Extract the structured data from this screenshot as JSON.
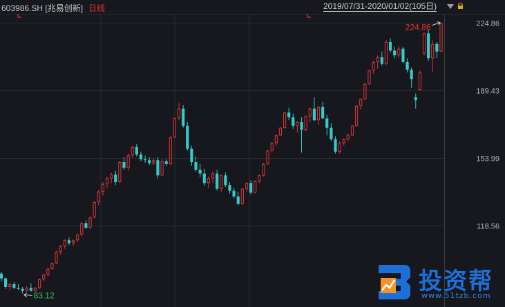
{
  "header": {
    "symbol": "603986.SH",
    "name": "[兆易创新]",
    "period": "日线",
    "date_range": "2019/07/31-2020/01/02(105日)"
  },
  "watermark": {
    "brand": "投资帮",
    "url": "www.51tzb.com"
  },
  "colors": {
    "up": "#e0343a",
    "down": "#36c9c9",
    "background": "#16181d",
    "grid": "#2a2d33",
    "axis_text": "#b4b4b4"
  },
  "chart_data": {
    "type": "candlestick",
    "title": "603986.SH [兆易创新] 日线",
    "period": "2019/07/31-2020/01/02",
    "bar_count": 105,
    "y_ticks": [
      118.56,
      153.99,
      189.43,
      224.86
    ],
    "ylim": [
      76.0,
      229.8
    ],
    "grid": true,
    "annotations": {
      "high": 224.86,
      "low": 83.12
    },
    "ohlc": [
      [
        93.5,
        94.5,
        89.5,
        91.0
      ],
      [
        91.0,
        91.5,
        85.5,
        86.5
      ],
      [
        86.5,
        88.5,
        84.5,
        88.0
      ],
      [
        88.0,
        89.0,
        85.5,
        86.0
      ],
      [
        86.0,
        88.0,
        85.0,
        85.5
      ],
      [
        85.5,
        86.5,
        83.12,
        84.5
      ],
      [
        84.5,
        87.0,
        83.5,
        86.0
      ],
      [
        86.0,
        88.5,
        84.0,
        84.5
      ],
      [
        84.5,
        86.5,
        83.5,
        86.0
      ],
      [
        86.0,
        91.0,
        85.5,
        90.5
      ],
      [
        90.5,
        93.5,
        89.5,
        93.0
      ],
      [
        93.0,
        96.5,
        92.0,
        96.0
      ],
      [
        96.0,
        99.5,
        95.5,
        99.0
      ],
      [
        99.0,
        105.5,
        98.5,
        105.0
      ],
      [
        105.0,
        108.5,
        103.5,
        108.0
      ],
      [
        108.0,
        111.5,
        106.5,
        111.0
      ],
      [
        111.0,
        112.5,
        108.5,
        109.5
      ],
      [
        109.5,
        111.5,
        108.0,
        111.0
      ],
      [
        111.0,
        114.5,
        110.0,
        114.0
      ],
      [
        114.0,
        120.5,
        113.0,
        120.0
      ],
      [
        120.0,
        121.5,
        117.0,
        117.5
      ],
      [
        117.5,
        123.5,
        117.0,
        123.0
      ],
      [
        123.0,
        131.5,
        122.5,
        131.0
      ],
      [
        131.0,
        137.5,
        129.5,
        136.5
      ],
      [
        136.5,
        141.5,
        134.5,
        140.5
      ],
      [
        140.5,
        144.5,
        138.5,
        143.5
      ],
      [
        143.5,
        146.5,
        141.0,
        145.5
      ],
      [
        145.5,
        147.5,
        140.0,
        141.5
      ],
      [
        141.5,
        152.5,
        141.0,
        152.0
      ],
      [
        152.0,
        154.5,
        148.0,
        149.0
      ],
      [
        149.0,
        156.5,
        147.5,
        155.5
      ],
      [
        155.5,
        160.5,
        154.5,
        160.0
      ],
      [
        160.0,
        161.5,
        155.0,
        156.0
      ],
      [
        156.0,
        157.5,
        152.5,
        153.5
      ],
      [
        153.5,
        155.5,
        151.5,
        153.0
      ],
      [
        153.0,
        154.5,
        150.5,
        151.5
      ],
      [
        151.5,
        154.0,
        150.5,
        153.0
      ],
      [
        153.0,
        154.5,
        143.5,
        145.0
      ],
      [
        145.0,
        153.5,
        144.5,
        152.5
      ],
      [
        152.5,
        153.5,
        150.0,
        151.0
      ],
      [
        151.0,
        165.5,
        150.5,
        165.0
      ],
      [
        165.0,
        175.5,
        164.5,
        175.0
      ],
      [
        175.0,
        183.0,
        174.0,
        180.0
      ],
      [
        180.0,
        182.0,
        170.0,
        171.0
      ],
      [
        171.0,
        173.0,
        158.0,
        159.0
      ],
      [
        159.0,
        160.5,
        150.0,
        152.0
      ],
      [
        152.0,
        155.0,
        147.0,
        148.0
      ],
      [
        148.0,
        151.0,
        144.0,
        146.0
      ],
      [
        146.0,
        148.5,
        139.5,
        141.0
      ],
      [
        141.0,
        144.5,
        138.5,
        143.5
      ],
      [
        143.5,
        147.0,
        141.0,
        146.0
      ],
      [
        146.0,
        148.0,
        137.0,
        138.0
      ],
      [
        138.0,
        145.5,
        136.5,
        145.0
      ],
      [
        145.0,
        146.5,
        139.0,
        140.0
      ],
      [
        140.0,
        141.5,
        135.5,
        137.0
      ],
      [
        137.0,
        138.5,
        133.0,
        134.0
      ],
      [
        134.0,
        136.5,
        129.5,
        130.0
      ],
      [
        130.0,
        138.5,
        129.5,
        138.0
      ],
      [
        138.0,
        141.5,
        136.5,
        141.0
      ],
      [
        141.0,
        142.5,
        135.0,
        136.0
      ],
      [
        136.0,
        142.5,
        135.5,
        142.0
      ],
      [
        142.0,
        145.5,
        141.0,
        145.0
      ],
      [
        145.0,
        151.5,
        144.5,
        151.0
      ],
      [
        151.0,
        158.5,
        150.5,
        158.0
      ],
      [
        158.0,
        162.5,
        157.0,
        162.0
      ],
      [
        162.0,
        166.5,
        160.5,
        166.0
      ],
      [
        166.0,
        170.5,
        165.5,
        170.0
      ],
      [
        170.0,
        178.5,
        169.5,
        178.0
      ],
      [
        178.0,
        180.5,
        174.0,
        175.5
      ],
      [
        175.5,
        177.5,
        169.5,
        171.0
      ],
      [
        171.0,
        173.5,
        167.5,
        173.0
      ],
      [
        173.0,
        175.5,
        157.0,
        169.0
      ],
      [
        169.0,
        176.5,
        168.0,
        176.0
      ],
      [
        176.0,
        180.5,
        173.0,
        180.0
      ],
      [
        180.0,
        186.0,
        173.5,
        174.0
      ],
      [
        174.0,
        181.5,
        171.5,
        181.0
      ],
      [
        181.0,
        183.5,
        174.5,
        175.0
      ],
      [
        175.0,
        177.0,
        166.0,
        170.0
      ],
      [
        170.0,
        172.5,
        163.0,
        164.0
      ],
      [
        164.0,
        165.5,
        156.5,
        157.5
      ],
      [
        157.5,
        163.0,
        156.5,
        162.0
      ],
      [
        162.0,
        164.5,
        160.5,
        164.0
      ],
      [
        164.0,
        167.0,
        163.0,
        166.0
      ],
      [
        166.0,
        171.5,
        165.5,
        171.0
      ],
      [
        171.0,
        182.0,
        170.5,
        181.5
      ],
      [
        181.5,
        185.5,
        179.5,
        185.0
      ],
      [
        185.0,
        193.5,
        184.5,
        193.0
      ],
      [
        193.0,
        200.5,
        192.5,
        200.0
      ],
      [
        200.0,
        205.0,
        198.5,
        204.5
      ],
      [
        204.5,
        208.0,
        201.0,
        207.0
      ],
      [
        207.0,
        210.0,
        202.5,
        203.5
      ],
      [
        203.5,
        216.0,
        203.0,
        215.0
      ],
      [
        215.0,
        217.0,
        209.5,
        210.5
      ],
      [
        210.5,
        212.5,
        206.5,
        208.0
      ],
      [
        208.0,
        213.0,
        206.5,
        211.5
      ],
      [
        211.5,
        212.5,
        204.0,
        204.5
      ],
      [
        204.5,
        206.5,
        199.0,
        200.5
      ],
      [
        200.5,
        201.5,
        191.0,
        195.5
      ],
      [
        186.0,
        188.0,
        180.0,
        184.5
      ],
      [
        190.0,
        200.0,
        189.5,
        199.0
      ],
      [
        209.0,
        220.0,
        208.0,
        219.5
      ],
      [
        219.5,
        221.5,
        205.0,
        206.5
      ],
      [
        206.5,
        216.0,
        199.5,
        214.0
      ],
      [
        214.0,
        215.0,
        206.5,
        210.0
      ],
      [
        210.0,
        224.86,
        209.5,
        224.86
      ]
    ]
  }
}
